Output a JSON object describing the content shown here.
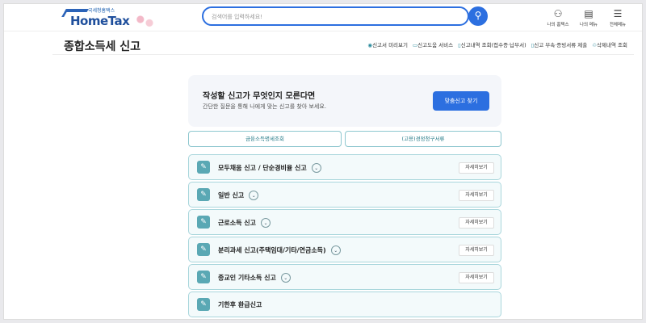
{
  "header": {
    "logo_small": "국세청홈택스",
    "logo": "HomeTax",
    "search_placeholder": "검색어를 입력하세요!",
    "icons": [
      {
        "label": "나의 홈택스",
        "icon": "user-bell-icon",
        "g": "⚇"
      },
      {
        "label": "나의 메뉴",
        "icon": "doc-bell-icon",
        "g": "▤"
      },
      {
        "label": "전체메뉴",
        "icon": "menu-icon",
        "g": "☰"
      }
    ]
  },
  "page": {
    "title": "종합소득세 신고",
    "links": [
      "신고서 미리보기",
      "신고도움 서비스",
      "신고내역 조회(접수증·납부서)",
      "신고 부속·증빙서류 제출",
      "삭제내역 조회"
    ]
  },
  "card": {
    "heading": "작성할 신고가 무엇인지 모른다면",
    "sub": "간단한 질문을 통해 나에게 맞는 신고를 찾아 보세요.",
    "button": "맞춤신고 찾기"
  },
  "tabs": [
    "금융소득명세조회",
    "(고용)경정청구서류"
  ],
  "items": [
    {
      "label": "모두채움 신고 / 단순경비율 신고",
      "detail": "자세히보기"
    },
    {
      "label": "일반 신고",
      "detail": "자세히보기"
    },
    {
      "label": "근로소득 신고",
      "detail": "자세히보기"
    },
    {
      "label": "분리과세 신고(주택임대/기타/연금소득)",
      "detail": "자세히보기"
    },
    {
      "label": "종교인 기타소득 신고",
      "detail": "자세히보기"
    },
    {
      "label": "기한후 환급신고"
    }
  ]
}
